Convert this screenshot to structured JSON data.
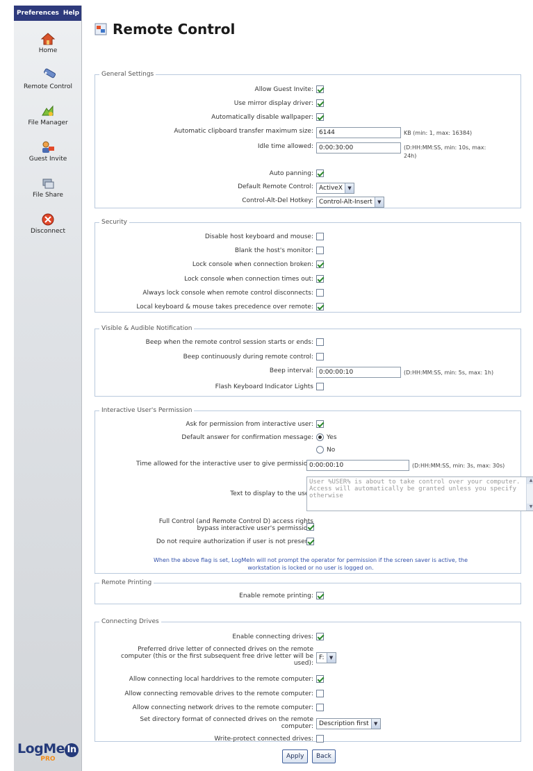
{
  "menu": {
    "preferences": "Preferences",
    "help": "Help"
  },
  "nav": [
    {
      "label": "Home",
      "icon": "home-icon"
    },
    {
      "label": "Remote Control",
      "icon": "remote-control-icon"
    },
    {
      "label": "File Manager",
      "icon": "file-manager-icon"
    },
    {
      "label": "Guest Invite",
      "icon": "guest-invite-icon"
    },
    {
      "label": "File Share",
      "icon": "file-share-icon"
    },
    {
      "label": "Disconnect",
      "icon": "disconnect-icon"
    }
  ],
  "logo": {
    "wordmark": "LogMe",
    "circle": "In",
    "sub": "PRO"
  },
  "page_title": "Remote Control",
  "general": {
    "legend": "General Settings",
    "allow_guest_invite": {
      "label": "Allow Guest Invite:",
      "checked": true
    },
    "mirror_driver": {
      "label": "Use mirror display driver:",
      "checked": true
    },
    "disable_wallpaper": {
      "label": "Automatically disable wallpaper:",
      "checked": true
    },
    "clipboard": {
      "label": "Automatic clipboard transfer maximum size:",
      "value": "6144",
      "hint": "KB (min: 1, max: 16384)"
    },
    "idle": {
      "label": "Idle time allowed:",
      "value": "0:00:30:00",
      "hint1": "(D:HH:MM:SS, min: 10s, max:",
      "hint2": "24h)"
    },
    "auto_panning": {
      "label": "Auto panning:",
      "checked": true
    },
    "default_rc": {
      "label": "Default Remote Control:",
      "value": "ActiveX"
    },
    "cad_hotkey": {
      "label": "Control-Alt-Del Hotkey:",
      "value": "Control-Alt-Insert"
    }
  },
  "security": {
    "legend": "Security",
    "disable_kb": {
      "label": "Disable host keyboard and mouse:",
      "checked": false
    },
    "blank": {
      "label": "Blank the host's monitor:",
      "checked": false
    },
    "lock_broken": {
      "label": "Lock console when connection broken:",
      "checked": true
    },
    "lock_timeout": {
      "label": "Lock console when connection times out:",
      "checked": true
    },
    "always_lock": {
      "label": "Always lock console when remote control disconnects:",
      "checked": false
    },
    "local_precedence": {
      "label": "Local keyboard & mouse takes precedence over remote:",
      "checked": true
    }
  },
  "notify": {
    "legend": "Visible & Audible Notification",
    "beep_start": {
      "label": "Beep when the remote control session starts or ends:",
      "checked": false
    },
    "beep_cont": {
      "label": "Beep continuously during remote control:",
      "checked": false
    },
    "interval": {
      "label": "Beep interval:",
      "value": "0:00:00:10",
      "hint": "(D:HH:MM:SS, min: 5s, max: 1h)"
    },
    "flash": {
      "label": "Flash Keyboard Indicator Lights",
      "checked": false
    }
  },
  "permission": {
    "legend": "Interactive User's Permission",
    "ask": {
      "label": "Ask for permission from interactive user:",
      "checked": true
    },
    "default_answer": {
      "label": "Default answer for confirmation message:",
      "yes": "Yes",
      "no": "No",
      "selected": "Yes"
    },
    "time": {
      "label": "Time allowed for the interactive user to give permission:",
      "value": "0:00:00:10",
      "hint": "(D:HH:MM:SS, min: 3s, max: 30s)"
    },
    "text": {
      "label": "Text to display to the user:",
      "value": "User %USER% is about to take control over your computer. Access will automatically be granted unless you specify otherwise"
    },
    "full_control": {
      "label1": "Full Control (and Remote Control D) access rights",
      "label2": "bypass interactive user's permission:",
      "checked": true
    },
    "no_auth": {
      "label": "Do not require authorization if user is not present:",
      "checked": true
    },
    "note1": "When the above flag is set, LogMeIn will not prompt the operator for permission if the screen saver is active, the",
    "note2": "workstation is locked or no user is logged on."
  },
  "printing": {
    "legend": "Remote Printing",
    "enable": {
      "label": "Enable remote printing:",
      "checked": true
    }
  },
  "drives": {
    "legend": "Connecting Drives",
    "enable": {
      "label": "Enable connecting drives:",
      "checked": true
    },
    "letter": {
      "label1": "Preferred drive letter of connected drives on the remote",
      "label2": "computer (this or the first subsequent free drive letter will be",
      "label3": "used):",
      "value": "F:"
    },
    "local_hd": {
      "label": "Allow connecting local harddrives to the remote computer:",
      "checked": true
    },
    "removable": {
      "label": "Allow connecting removable drives to the remote computer:",
      "checked": false
    },
    "network": {
      "label": "Allow connecting network drives to the remote computer:",
      "checked": false
    },
    "format": {
      "label1": "Set directory format of connected drives on the remote",
      "label2": "computer:",
      "value": "Description first"
    },
    "write_protect": {
      "label": "Write-protect connected drives:",
      "checked": false
    }
  },
  "buttons": {
    "apply": "Apply",
    "back": "Back"
  }
}
